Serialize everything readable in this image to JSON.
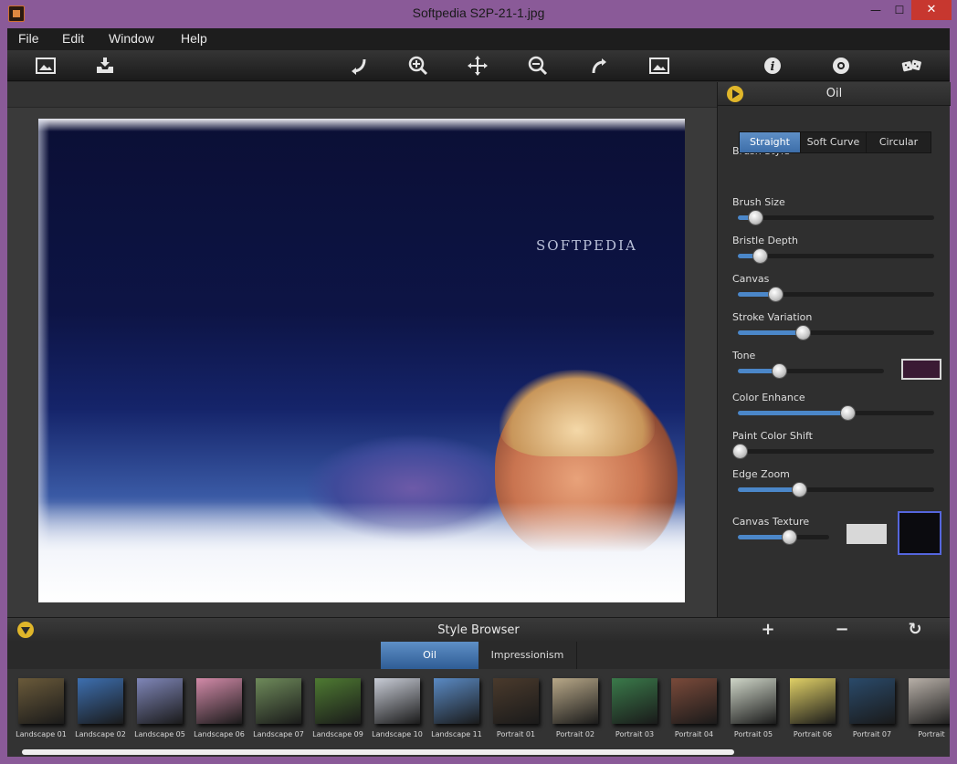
{
  "window": {
    "title": "Softpedia S2P-21-1.jpg",
    "min": "—",
    "max": "☐",
    "close": "✕"
  },
  "menu": [
    "File",
    "Edit",
    "Window",
    "Help"
  ],
  "toolbar": {
    "icons": [
      "open-image-icon",
      "save-icon",
      "rotate-left-icon",
      "zoom-in-icon",
      "pan-icon",
      "zoom-out-icon",
      "rotate-right-icon",
      "fit-image-icon",
      "info-icon",
      "settings-icon",
      "random-dice-icon"
    ]
  },
  "canvas": {
    "watermark": "SOFTPEDIA"
  },
  "panel": {
    "title": "Oil",
    "brush_style_label": "Brush Style",
    "brush_styles": [
      "Straight",
      "Soft Curve",
      "Circular"
    ],
    "active_brush_style": "Straight",
    "sliders": [
      {
        "label": "Brush Size",
        "value": 0.09
      },
      {
        "label": "Bristle Depth",
        "value": 0.11
      },
      {
        "label": "Canvas",
        "value": 0.19
      },
      {
        "label": "Stroke Variation",
        "value": 0.33
      },
      {
        "label": "Tone",
        "value": 0.28
      },
      {
        "label": "Color Enhance",
        "value": 0.56
      },
      {
        "label": "Paint Color Shift",
        "value": 0.01
      },
      {
        "label": "Edge Zoom",
        "value": 0.31
      },
      {
        "label": "Canvas Texture",
        "value": 0.56
      }
    ],
    "tone_color": "#3a1a34",
    "texture_color_a": "#d8d8d8",
    "texture_color_b": "#0b0b0f"
  },
  "style_browser": {
    "title": "Style Browser",
    "add": "+",
    "remove": "−",
    "refresh": "↻",
    "tabs": [
      "Oil",
      "Impressionism"
    ],
    "active_tab": "Oil",
    "items": [
      {
        "label": "Landscape 01",
        "color": "#6a5a3a"
      },
      {
        "label": "Landscape 02",
        "color": "#3d6fb0"
      },
      {
        "label": "Landscape 05",
        "color": "#7f86b8"
      },
      {
        "label": "Landscape 06",
        "color": "#d28aa8"
      },
      {
        "label": "Landscape 07",
        "color": "#6e8a5a"
      },
      {
        "label": "Landscape 09",
        "color": "#4e7a32"
      },
      {
        "label": "Landscape 10",
        "color": "#c8ccd6"
      },
      {
        "label": "Landscape 11",
        "color": "#5a8ac4"
      },
      {
        "label": "Portrait 01",
        "color": "#4a3a2c"
      },
      {
        "label": "Portrait 02",
        "color": "#b8a888"
      },
      {
        "label": "Portrait 03",
        "color": "#3a7a4a"
      },
      {
        "label": "Portrait 04",
        "color": "#7a4a3a"
      },
      {
        "label": "Portrait 05",
        "color": "#cfd6c8"
      },
      {
        "label": "Portrait 06",
        "color": "#e0d066"
      },
      {
        "label": "Portrait 07",
        "color": "#2a4a6a"
      },
      {
        "label": "Portrait",
        "color": "#b8b0a8"
      }
    ]
  }
}
